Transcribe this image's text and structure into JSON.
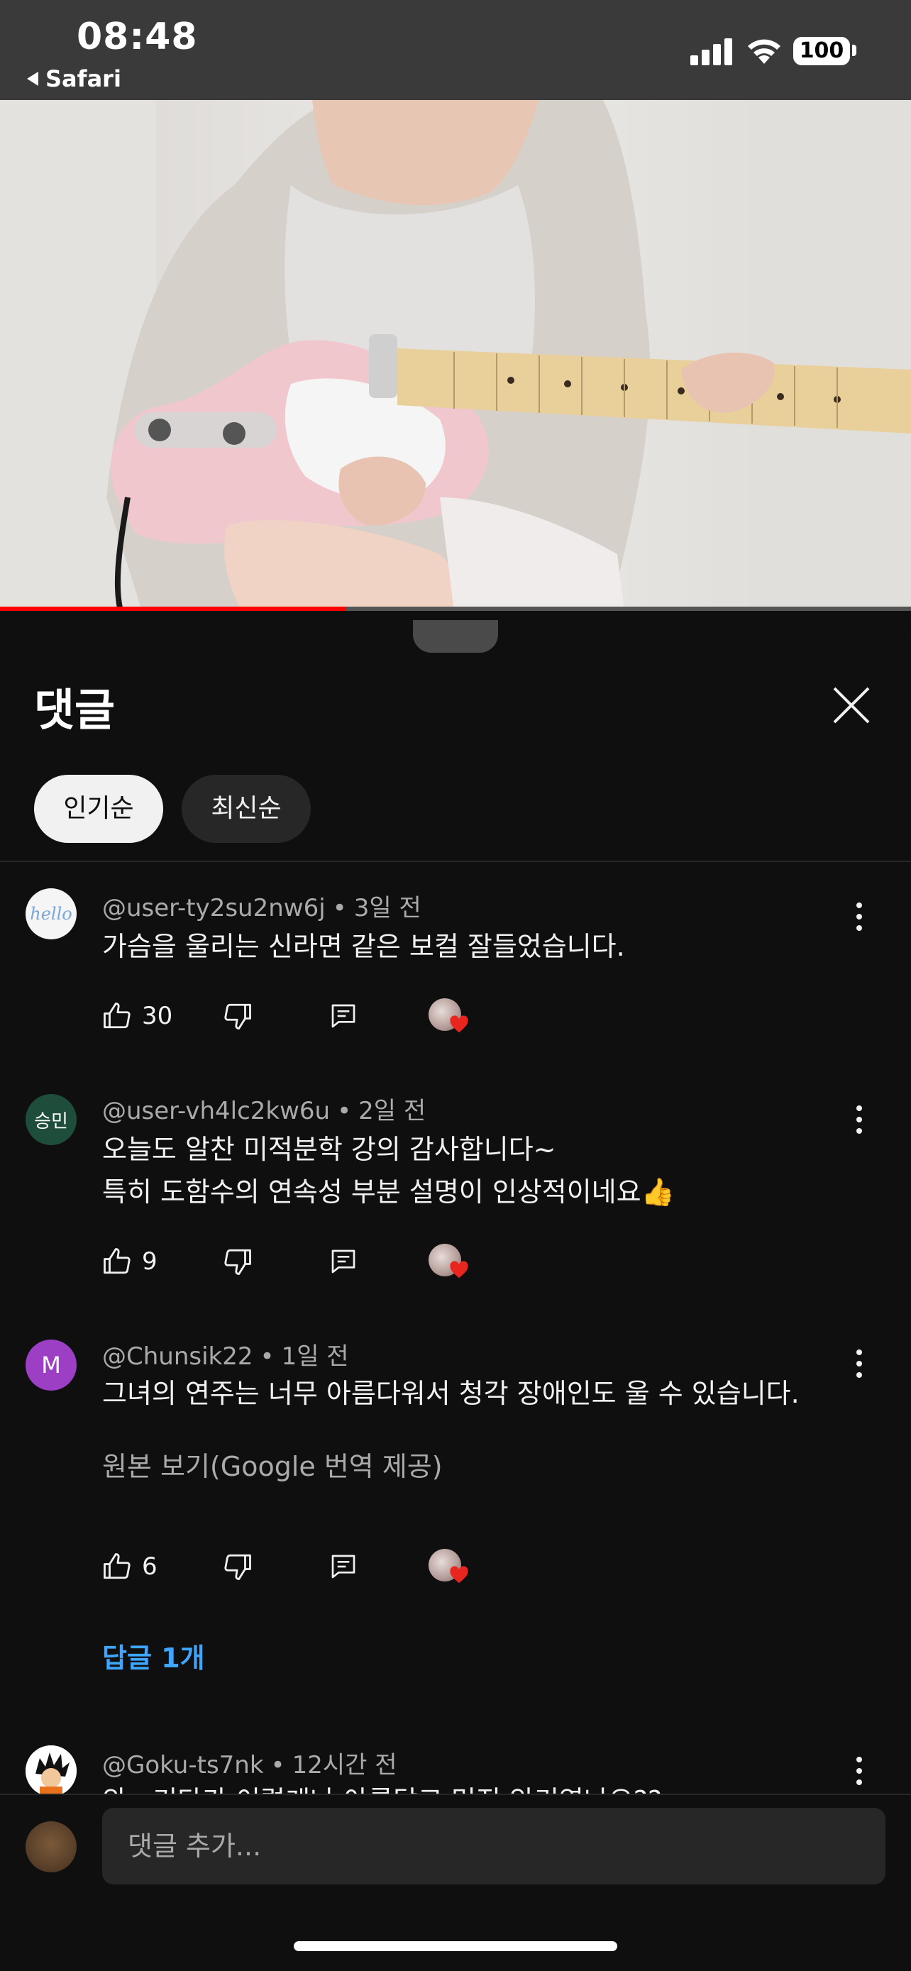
{
  "status_bar": {
    "time": "08:48",
    "back_label": "Safari",
    "battery": "100"
  },
  "video": {
    "progress_fraction": 0.38
  },
  "sheet": {
    "title": "댓글",
    "chips": [
      {
        "label": "인기순",
        "selected": true
      },
      {
        "label": "최신순",
        "selected": false
      }
    ]
  },
  "comments": [
    {
      "author": "@user-ty2su2nw6j",
      "time": "3일 전",
      "lines": [
        "가슴을 울리는 신라면 같은 보컬 잘들었습니다."
      ],
      "likes": "30",
      "avatar_text": "hello",
      "avatar_color": "#f5f5f5"
    },
    {
      "author": "@user-vh4lc2kw6u",
      "time": "2일 전",
      "lines": [
        "오늘도 알찬 미적분학 강의 감사합니다~",
        "특히 도함수의 연속성 부분 설명이 인상적이네요👍"
      ],
      "likes": "9",
      "avatar_text": "승민",
      "avatar_color": "#1e4d3c"
    },
    {
      "author": "@Chunsik22",
      "time": "1일 전",
      "lines": [
        "그녀의 연주는 너무 아름다워서 청각 장애인도 울 수 있습니다."
      ],
      "translate_label": "원본 보기(Google 번역 제공)",
      "likes": "6",
      "replies_label": "답글 1개",
      "avatar_text": "M",
      "avatar_color": "#9c3fc4"
    },
    {
      "author": "@Goku-ts7nk",
      "time": "12시간 전",
      "lines": [
        "와.. 기타가 이렇게나 아름답고 멋진 악기였나요??"
      ]
    }
  ],
  "input": {
    "placeholder": "댓글 추가..."
  },
  "colors": {
    "background": "#0f0f0f",
    "chip_selected": "#f1f1f1",
    "chip_unselected": "#272727",
    "link": "#3ea6ff",
    "progress": "#ff0000",
    "heart": "#e8251f"
  }
}
